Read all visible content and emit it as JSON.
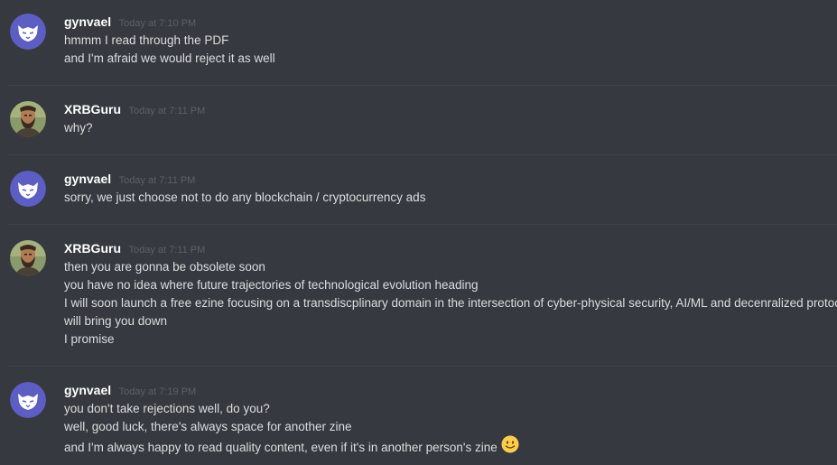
{
  "messages": [
    {
      "author": "gynvael",
      "avatar": "cat-avatar-icon",
      "timestamp": "Today at 7:10 PM",
      "lines": [
        "hmmm I read through the PDF",
        "and I'm afraid we would reject it as well"
      ]
    },
    {
      "author": "XRBGuru",
      "avatar": "bearded-man-avatar-icon",
      "timestamp": "Today at 7:11 PM",
      "lines": [
        "why?"
      ]
    },
    {
      "author": "gynvael",
      "avatar": "cat-avatar-icon",
      "timestamp": "Today at 7:11 PM",
      "lines": [
        "sorry, we just choose not to do any blockchain / cryptocurrency ads"
      ]
    },
    {
      "author": "XRBGuru",
      "avatar": "bearded-man-avatar-icon",
      "timestamp": "Today at 7:11 PM",
      "lines": [
        "then you are gonna be obsolete soon",
        "you have no idea where future trajectories of technological evolution heading",
        "I will soon launch a free ezine focusing on a transdiscplinary domain in the intersection of cyber-physical security, AI/ML and decenralized protocols",
        "will bring you down",
        "I promise"
      ]
    },
    {
      "author": "gynvael",
      "avatar": "cat-avatar-icon",
      "timestamp": "Today at 7:19 PM",
      "lines": [
        "you don't take rejections well, do you?",
        "well, good luck, there's always space for another zine",
        "and I'm always happy to read quality content, even if it's in another person's zine"
      ],
      "trailing_emoji": "slightly-smiling-face-icon"
    }
  ],
  "colors": {
    "background": "#36393f",
    "divider": "#40434a",
    "username": "#ffffff",
    "timestamp": "#5d6067",
    "message_text": "#dcddde",
    "cat_avatar_bg": "#5c5ec4"
  }
}
